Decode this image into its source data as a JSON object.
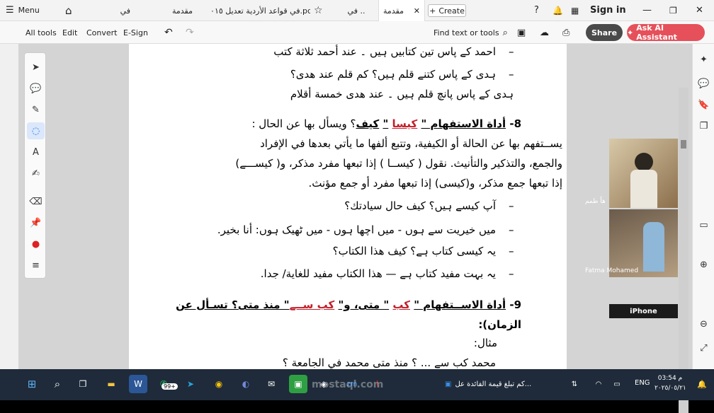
{
  "topbar": {
    "menu_label": "Menu",
    "tabs": [
      "في",
      "مقدمة",
      "في قواعد الأردية تعديل ٢٠١٥.pdf",
      "في ..",
      "مقدمة"
    ],
    "create_label": "Create",
    "signin_label": "Sign in"
  },
  "toolbar": {
    "all_tools": "All tools",
    "edit": "Edit",
    "convert": "Convert",
    "esign": "E-Sign",
    "find": "Find text or tools",
    "share": "Share",
    "ai": "Ask AI Assistant"
  },
  "document": {
    "lines": [
      "احمد کے پاس تین کتابیں ہیں ۔ عند أحمد ثلاثة كتب",
      "ہدی کے پاس کتنے قلم ہیں؟   كم قلم عند هدى؟",
      "ہدی کے پاس پانچ قلم ہیں ۔ عند هدى خمسة أقلام",
      "8- أداة الاستفهام \" كيسا \" كيف؟ ويسأل بها عن الحال :",
      "يســتفهم بها عن الحالة أو الكيفية، وتتبع ألفها ما يأتي بعدها في الإفراد",
      "والجمع، والتذكير والتأنيث. نقول ( كيســا ) إذا تبعها مفرد مذكر، و( كيســـے)",
      "إذا تبعها جمع مذكر، و(كيسى) إذا تبعها مفرد أو جمع مؤنث.",
      "آپ کیسے ہیں؟ كيف حال سيادتك؟",
      "میں خیریت سے ہوں - میں اچھا ہوں - میں ٹھیک ہوں:   أنا بخير.",
      "یہ کیسی کتاب ہے؟ كيف هذا الكتاب؟",
      "یہ بہت مفید کتاب ہے — هذا الكتاب مفيد للغاية/ جدا.",
      "9- أداة الاســتفهام \" كب \" متى، و\" كب ســے\" منذ متى؟ تسـأل عن",
      "الزمان):",
      "مثال:",
      "محمد کب سے ... ؟ منذ متى محمد في الجامعة ؟"
    ],
    "heading8_red": "كيسا",
    "heading8_bold": "كيف",
    "heading9_red1": "كب",
    "heading9_red2": "كب ســے"
  },
  "video": {
    "side_label": "هاً طمم",
    "participant": "Fatma Mohamed",
    "device": "iPhone"
  },
  "taskbar": {
    "badge": "99+",
    "window_title": "كم تبلغ قيمة الفائدة عل...",
    "lang": "ENG",
    "time": "03:54 م",
    "date": "٢٠٢٥/٠٥/٢١",
    "watermark": "mostaql.com"
  }
}
